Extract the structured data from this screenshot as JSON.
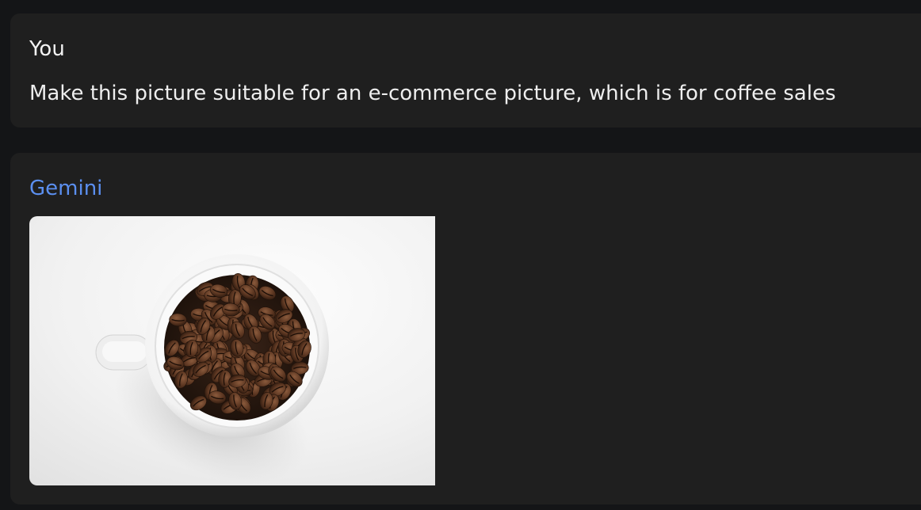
{
  "conversation": {
    "user_turn": {
      "author": "You",
      "message": "Make this picture suitable for an e-commerce picture, which is for coffee sales"
    },
    "model_turn": {
      "author": "Gemini",
      "image": {
        "subject": "white cup filled with roasted coffee beans on white background",
        "author_color": "#5b8ff0"
      }
    }
  }
}
